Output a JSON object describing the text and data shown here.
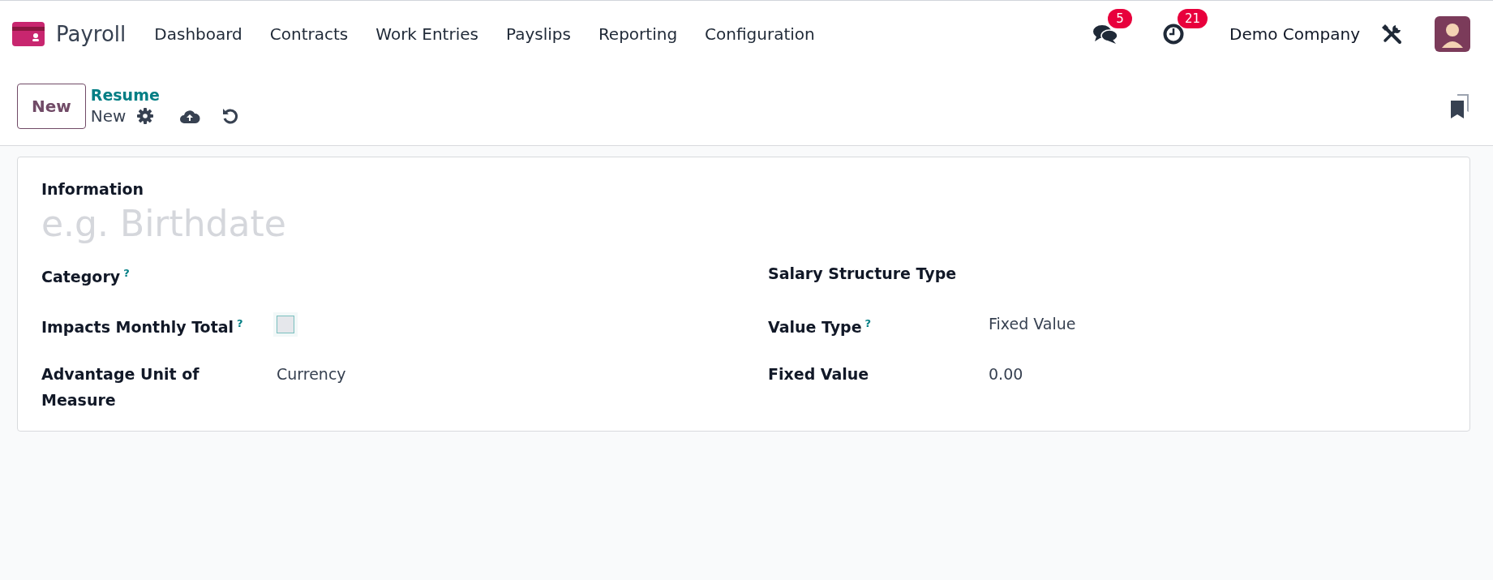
{
  "navbar": {
    "app_name": "Payroll",
    "menu": [
      "Dashboard",
      "Contracts",
      "Work Entries",
      "Payslips",
      "Reporting",
      "Configuration"
    ],
    "messages_count": "5",
    "activities_count": "21",
    "company": "Demo Company"
  },
  "control_panel": {
    "new_button": "New",
    "breadcrumb_parent": "Resume",
    "breadcrumb_current": "New"
  },
  "form": {
    "information_label": "Information",
    "information_placeholder": "e.g. Birthdate",
    "left_fields": [
      {
        "kind": "empty",
        "label": "Category",
        "help": "?"
      },
      {
        "kind": "checkbox",
        "label": "Impacts Monthly Total",
        "help": "?",
        "checked": false
      },
      {
        "kind": "text",
        "label": "Advantage Unit of Measure",
        "value": "Currency"
      }
    ],
    "right_fields": [
      {
        "kind": "empty",
        "label": "Salary Structure Type"
      },
      {
        "kind": "text",
        "label": "Value Type",
        "help": "?",
        "value": "Fixed Value"
      },
      {
        "kind": "text",
        "label": "Fixed Value",
        "value": "0.00"
      }
    ]
  }
}
